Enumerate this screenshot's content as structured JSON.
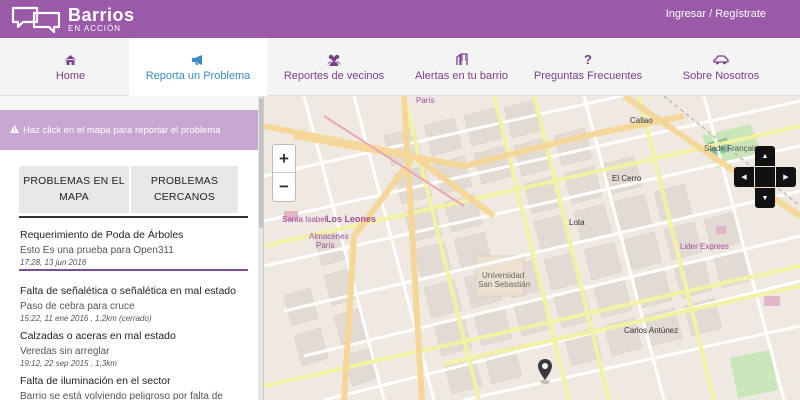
{
  "header": {
    "brand_title": "Barrios",
    "brand_subtitle": "EN ACCIÓN",
    "auth_link": "Ingresar / Regístrate"
  },
  "nav": {
    "items": [
      {
        "label": "Home",
        "icon": "home-icon"
      },
      {
        "label": "Reporta un Problema",
        "icon": "megaphone-icon",
        "active": true
      },
      {
        "label": "Reportes de vecinos",
        "icon": "users-icon"
      },
      {
        "label": "Alertas en tu barrio",
        "icon": "alert-building-icon"
      },
      {
        "label": "Preguntas Frecuentes",
        "icon": "question-icon"
      },
      {
        "label": "Sobre Nosotros",
        "icon": "car-icon"
      }
    ]
  },
  "sidebar": {
    "alert_text": "Haz click en el mapa para reportar el problema",
    "tab_map_line1": "PROBLEMAS EN EL",
    "tab_map_line2": "MAPA",
    "tab_near_line1": "PROBLEMAS",
    "tab_near_line2": "CERCANOS",
    "reports": [
      {
        "title": "Requerimiento de Poda de Árboles",
        "desc": "Esto Es una prueba para Open311",
        "meta": "17:28, 13 jun 2016"
      },
      {
        "title": "Falta de señalética o señalética en mal estado",
        "desc": "Paso de cebra para cruce",
        "meta": "15:22, 11 ene 2016 , 1,2km (cerrado)"
      },
      {
        "title": "Calzadas o aceras en mal estado",
        "desc": "Veredas sin arreglar",
        "meta": "19:12, 22 sep 2015 , 1,3km"
      },
      {
        "title": "Falta de iluminación en el sector",
        "desc": "Barrio se está volviendo peligroso por falta de",
        "meta": ""
      }
    ]
  },
  "map": {
    "zoom_in": "+",
    "zoom_out": "−",
    "labels": {
      "los_leones": "Los Leones",
      "universidad": "Universidad",
      "san_sebastian": "San Sebastián",
      "stade": "Stade Français",
      "paris": "París",
      "almacenes": "Almacenes",
      "almacenes2": "París",
      "santa_isabel": "Santa Isabel",
      "lider": "Lider Express",
      "lota": "Lota",
      "carlos_antunez": "Carlos Antúnez",
      "callao": "Callao",
      "el_cerro": "El Cerro"
    },
    "colors": {
      "land": "#efe9e1",
      "block": "#e2dbd3",
      "road_major": "#f6d79a",
      "road_minor": "#ffffff",
      "road_yellow": "#f3f1a3",
      "park": "#c9e6b8"
    }
  },
  "colors": {
    "header": "#9a5aa8",
    "accent_text": "#7b3f8c",
    "active_text": "#3a8bc8",
    "alert_bg": "#c8a7d2"
  }
}
